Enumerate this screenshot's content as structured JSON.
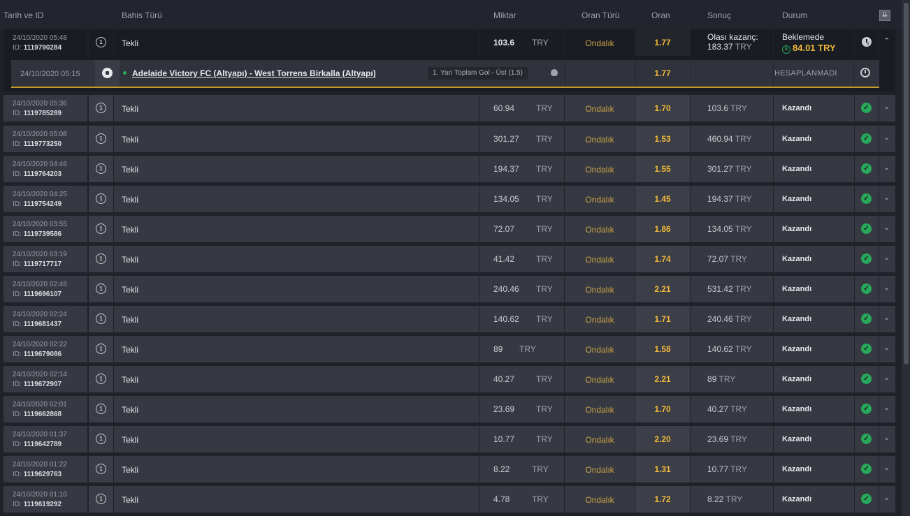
{
  "header": {
    "date_id": "Tarih ve ID",
    "bet_type": "Bahis Türü",
    "amount": "Miktar",
    "odds_type": "Oran Türü",
    "odds": "Oran",
    "result": "Sonuç",
    "status": "Durum",
    "collapse_icon": "double-chevron-down-icon"
  },
  "open_bet": {
    "date": "24/10/2020 05:48",
    "id_label": "ID:",
    "id": "1119790284",
    "num": "1",
    "type": "Tekli",
    "amount": "103.6",
    "currency": "TRY",
    "odds_type": "Ondalık",
    "odds": "1.77",
    "potential_label": "Olası kazanç:",
    "potential_value": "183.37",
    "potential_currency": "TRY",
    "status": "Beklemede",
    "cashout_value": "84.01 TRY",
    "cashout_icon": "dollar-coin-icon",
    "status_icon": "clock-icon"
  },
  "event": {
    "date": "24/10/2020 05:15",
    "sport_icon": "soccer-ball-icon",
    "match": "Adelaide Victory FC (Altyapı) - West Torrens Birkalla (Altyapı)",
    "market": "1. Yarı Toplam Gol - Üst (1.5)",
    "stats_icon": "stats-icon",
    "odds": "1.77",
    "status": "HESAPLANMADI"
  },
  "rows": [
    {
      "date": "24/10/2020 05:36",
      "id": "1119785289",
      "type": "Tekli",
      "amount": "60.94",
      "currency": "TRY",
      "odds_type": "Ondalık",
      "odds": "1.70",
      "result": "103.6",
      "result_currency": "TRY",
      "status": "Kazandı"
    },
    {
      "date": "24/10/2020 05:08",
      "id": "1119773250",
      "type": "Tekli",
      "amount": "301.27",
      "currency": "TRY",
      "odds_type": "Ondalık",
      "odds": "1.53",
      "result": "460.94",
      "result_currency": "TRY",
      "status": "Kazandı"
    },
    {
      "date": "24/10/2020 04:46",
      "id": "1119764203",
      "type": "Tekli",
      "amount": "194.37",
      "currency": "TRY",
      "odds_type": "Ondalık",
      "odds": "1.55",
      "result": "301.27",
      "result_currency": "TRY",
      "status": "Kazandı"
    },
    {
      "date": "24/10/2020 04:25",
      "id": "1119754249",
      "type": "Tekli",
      "amount": "134.05",
      "currency": "TRY",
      "odds_type": "Ondalık",
      "odds": "1.45",
      "result": "194.37",
      "result_currency": "TRY",
      "status": "Kazandı"
    },
    {
      "date": "24/10/2020 03:55",
      "id": "1119739586",
      "type": "Tekli",
      "amount": "72.07",
      "currency": "TRY",
      "odds_type": "Ondalık",
      "odds": "1.86",
      "result": "134.05",
      "result_currency": "TRY",
      "status": "Kazandı"
    },
    {
      "date": "24/10/2020 03:19",
      "id": "1119717717",
      "type": "Tekli",
      "amount": "41.42",
      "currency": "TRY",
      "odds_type": "Ondalık",
      "odds": "1.74",
      "result": "72.07",
      "result_currency": "TRY",
      "status": "Kazandı"
    },
    {
      "date": "24/10/2020 02:46",
      "id": "1119696107",
      "type": "Tekli",
      "amount": "240.46",
      "currency": "TRY",
      "odds_type": "Ondalık",
      "odds": "2.21",
      "result": "531.42",
      "result_currency": "TRY",
      "status": "Kazandı"
    },
    {
      "date": "24/10/2020 02:24",
      "id": "1119681437",
      "type": "Tekli",
      "amount": "140.62",
      "currency": "TRY",
      "odds_type": "Ondalık",
      "odds": "1.71",
      "result": "240.46",
      "result_currency": "TRY",
      "status": "Kazandı"
    },
    {
      "date": "24/10/2020 02:22",
      "id": "1119679086",
      "type": "Tekli",
      "amount": "89",
      "currency": "TRY",
      "odds_type": "Ondalık",
      "odds": "1.58",
      "result": "140.62",
      "result_currency": "TRY",
      "status": "Kazandı"
    },
    {
      "date": "24/10/2020 02:14",
      "id": "1119672907",
      "type": "Tekli",
      "amount": "40.27",
      "currency": "TRY",
      "odds_type": "Ondalık",
      "odds": "2.21",
      "result": "89",
      "result_currency": "TRY",
      "status": "Kazandı"
    },
    {
      "date": "24/10/2020 02:01",
      "id": "1119662868",
      "type": "Tekli",
      "amount": "23.69",
      "currency": "TRY",
      "odds_type": "Ondalık",
      "odds": "1.70",
      "result": "40.27",
      "result_currency": "TRY",
      "status": "Kazandı"
    },
    {
      "date": "24/10/2020 01:37",
      "id": "1119642789",
      "type": "Tekli",
      "amount": "10.77",
      "currency": "TRY",
      "odds_type": "Ondalık",
      "odds": "2.20",
      "result": "23.69",
      "result_currency": "TRY",
      "status": "Kazandı"
    },
    {
      "date": "24/10/2020 01:22",
      "id": "1119629763",
      "type": "Tekli",
      "amount": "8.22",
      "currency": "TRY",
      "odds_type": "Ondalık",
      "odds": "1.31",
      "result": "10.77",
      "result_currency": "TRY",
      "status": "Kazandı"
    },
    {
      "date": "24/10/2020 01:10",
      "id": "1119619292",
      "type": "Tekli",
      "amount": "4.78",
      "currency": "TRY",
      "odds_type": "Ondalık",
      "odds": "1.72",
      "result": "8.22",
      "result_currency": "TRY",
      "status": "Kazandı"
    }
  ],
  "icons": {
    "bet_count": "number-one-circle-icon",
    "won": "checkmark-circle-icon",
    "expand": "chevron-down-icon",
    "collapse": "chevron-up-icon"
  },
  "colors": {
    "background": "#1f2229",
    "row": "#363942",
    "odds": "#f0b93a",
    "odds_type": "#c9a247",
    "won": "#27a85a",
    "accent_line": "#c99b2a"
  },
  "id_label": "ID:"
}
